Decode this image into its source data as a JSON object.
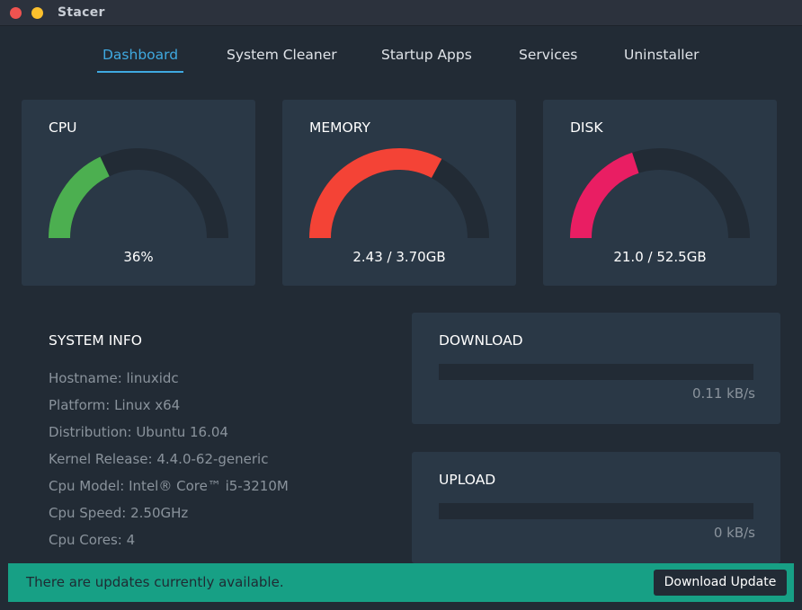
{
  "window": {
    "title": "Stacer"
  },
  "nav": {
    "tabs": [
      {
        "label": "Dashboard",
        "active": true
      },
      {
        "label": "System Cleaner",
        "active": false
      },
      {
        "label": "Startup Apps",
        "active": false
      },
      {
        "label": "Services",
        "active": false
      },
      {
        "label": "Uninstaller",
        "active": false
      }
    ]
  },
  "gauges": [
    {
      "title": "CPU",
      "value_text": "36%",
      "fraction": 0.36,
      "color": "#4caf50"
    },
    {
      "title": "MEMORY",
      "value_text": "2.43 / 3.70GB",
      "fraction": 0.657,
      "color": "#f44336"
    },
    {
      "title": "DISK",
      "value_text": "21.0 / 52.5GB",
      "fraction": 0.4,
      "color": "#e91e63"
    }
  ],
  "system_info": {
    "title": "SYSTEM INFO",
    "lines": [
      "Hostname: linuxidc",
      "Platform: Linux x64",
      "Distribution: Ubuntu 16.04",
      "Kernel Release: 4.4.0-62-generic",
      "Cpu Model: Intel® Core™ i5-3210M",
      "Cpu Speed: 2.50GHz",
      "Cpu Cores: 4"
    ]
  },
  "network": {
    "download": {
      "title": "DOWNLOAD",
      "value": "0.11 kB/s",
      "fraction": 0
    },
    "upload": {
      "title": "UPLOAD",
      "value": "0 kB/s",
      "fraction": 0
    }
  },
  "update_bar": {
    "message": "There are updates currently available.",
    "button_label": "Download Update"
  },
  "colors": {
    "accent": "#3fa9e0",
    "update_bar": "#17a085",
    "gauge_track": "#222b35"
  }
}
